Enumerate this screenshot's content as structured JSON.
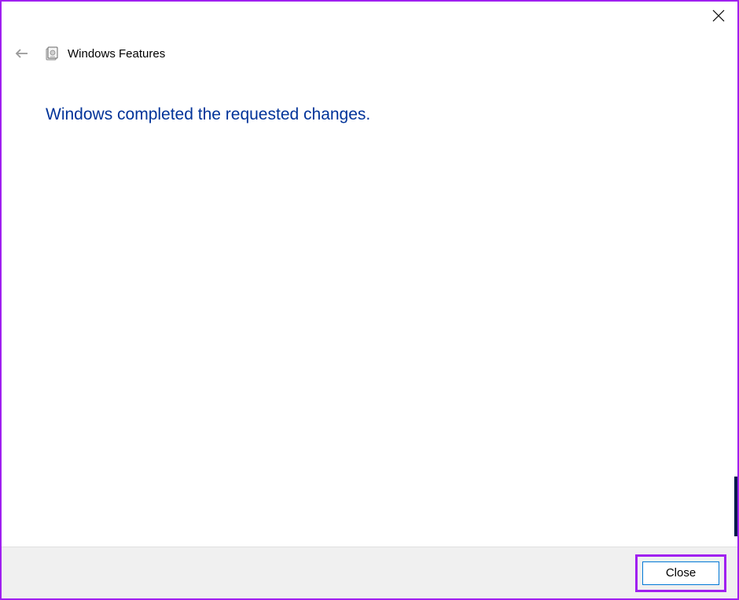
{
  "titlebar": {
    "close_icon": "close"
  },
  "header": {
    "back_icon": "back-arrow",
    "app_icon": "windows-features",
    "title": "Windows Features"
  },
  "content": {
    "message": "Windows completed the requested changes."
  },
  "footer": {
    "close_label": "Close"
  }
}
